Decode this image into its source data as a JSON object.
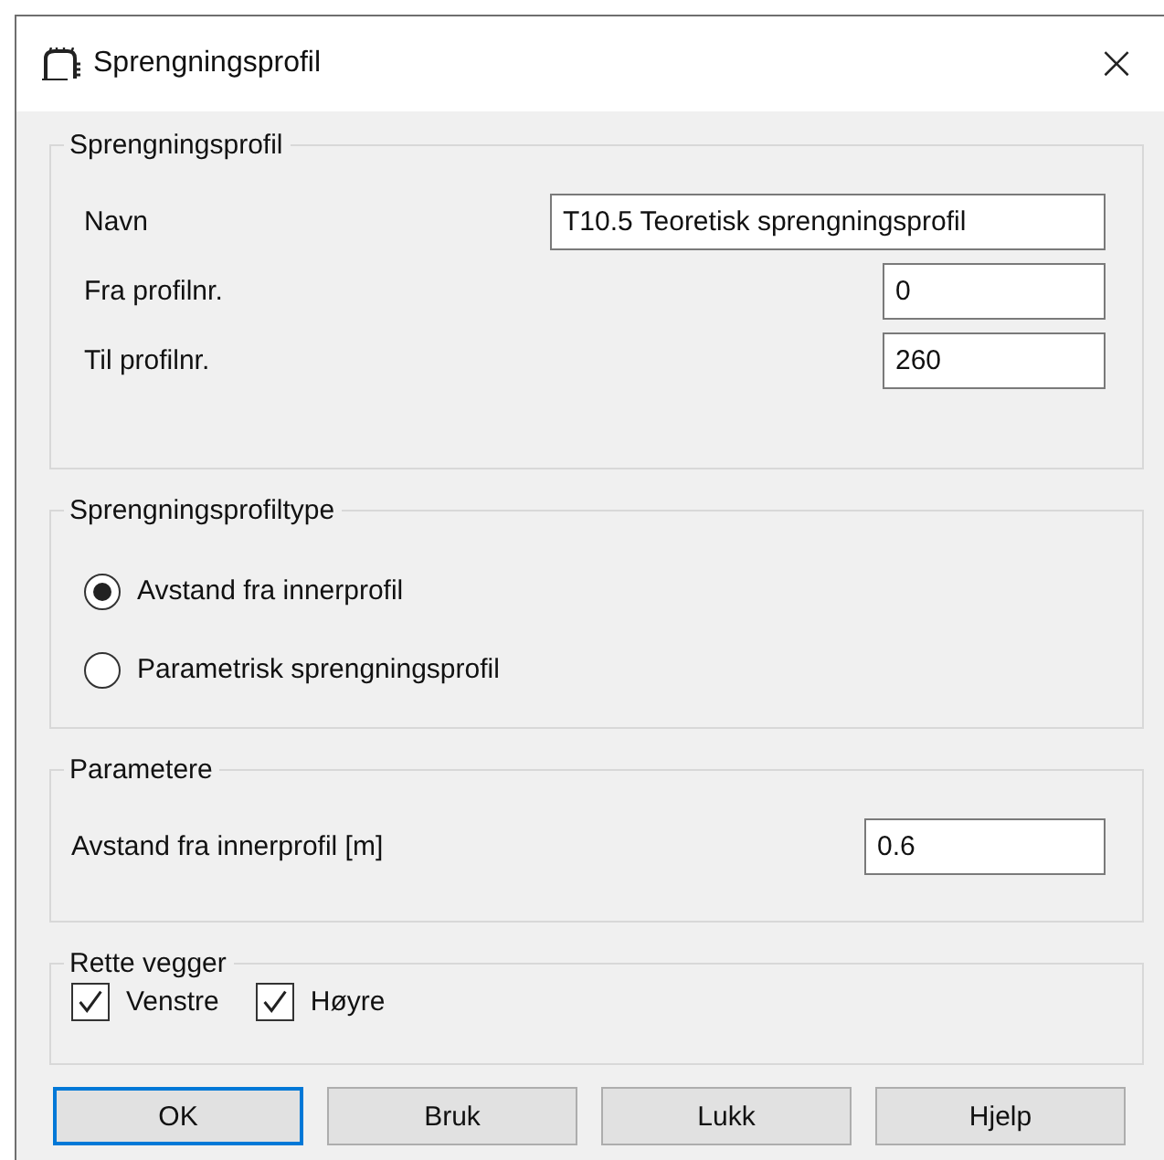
{
  "window": {
    "title": "Sprengningsprofil",
    "close": "×"
  },
  "profile": {
    "legend": "Sprengningsprofil",
    "fields": [
      {
        "label": "Navn",
        "value": "T10.5 Teoretisk sprengningsprofil",
        "kind": "wide"
      },
      {
        "label": "Fra profilnr.",
        "value": "0",
        "kind": "narrow"
      },
      {
        "label": "Til profilnr.",
        "value": "260",
        "kind": "narrow"
      }
    ]
  },
  "profile_type": {
    "legend": "Sprengningsprofiltype",
    "options": [
      {
        "label": "Avstand fra innerprofil",
        "selected": true
      },
      {
        "label": "Parametrisk sprengningsprofil",
        "selected": false
      }
    ]
  },
  "parameters": {
    "legend": "Parametere",
    "label": "Avstand fra innerprofil [m]",
    "value": "0.6"
  },
  "walls": {
    "legend": "Rette vegger",
    "checks": [
      {
        "label": "Venstre",
        "checked": true
      },
      {
        "label": "Høyre",
        "checked": true
      }
    ]
  },
  "buttons": [
    {
      "label": "OK",
      "default": true
    },
    {
      "label": "Bruk",
      "default": false
    },
    {
      "label": "Lukk",
      "default": false
    },
    {
      "label": "Hjelp",
      "default": false
    }
  ]
}
